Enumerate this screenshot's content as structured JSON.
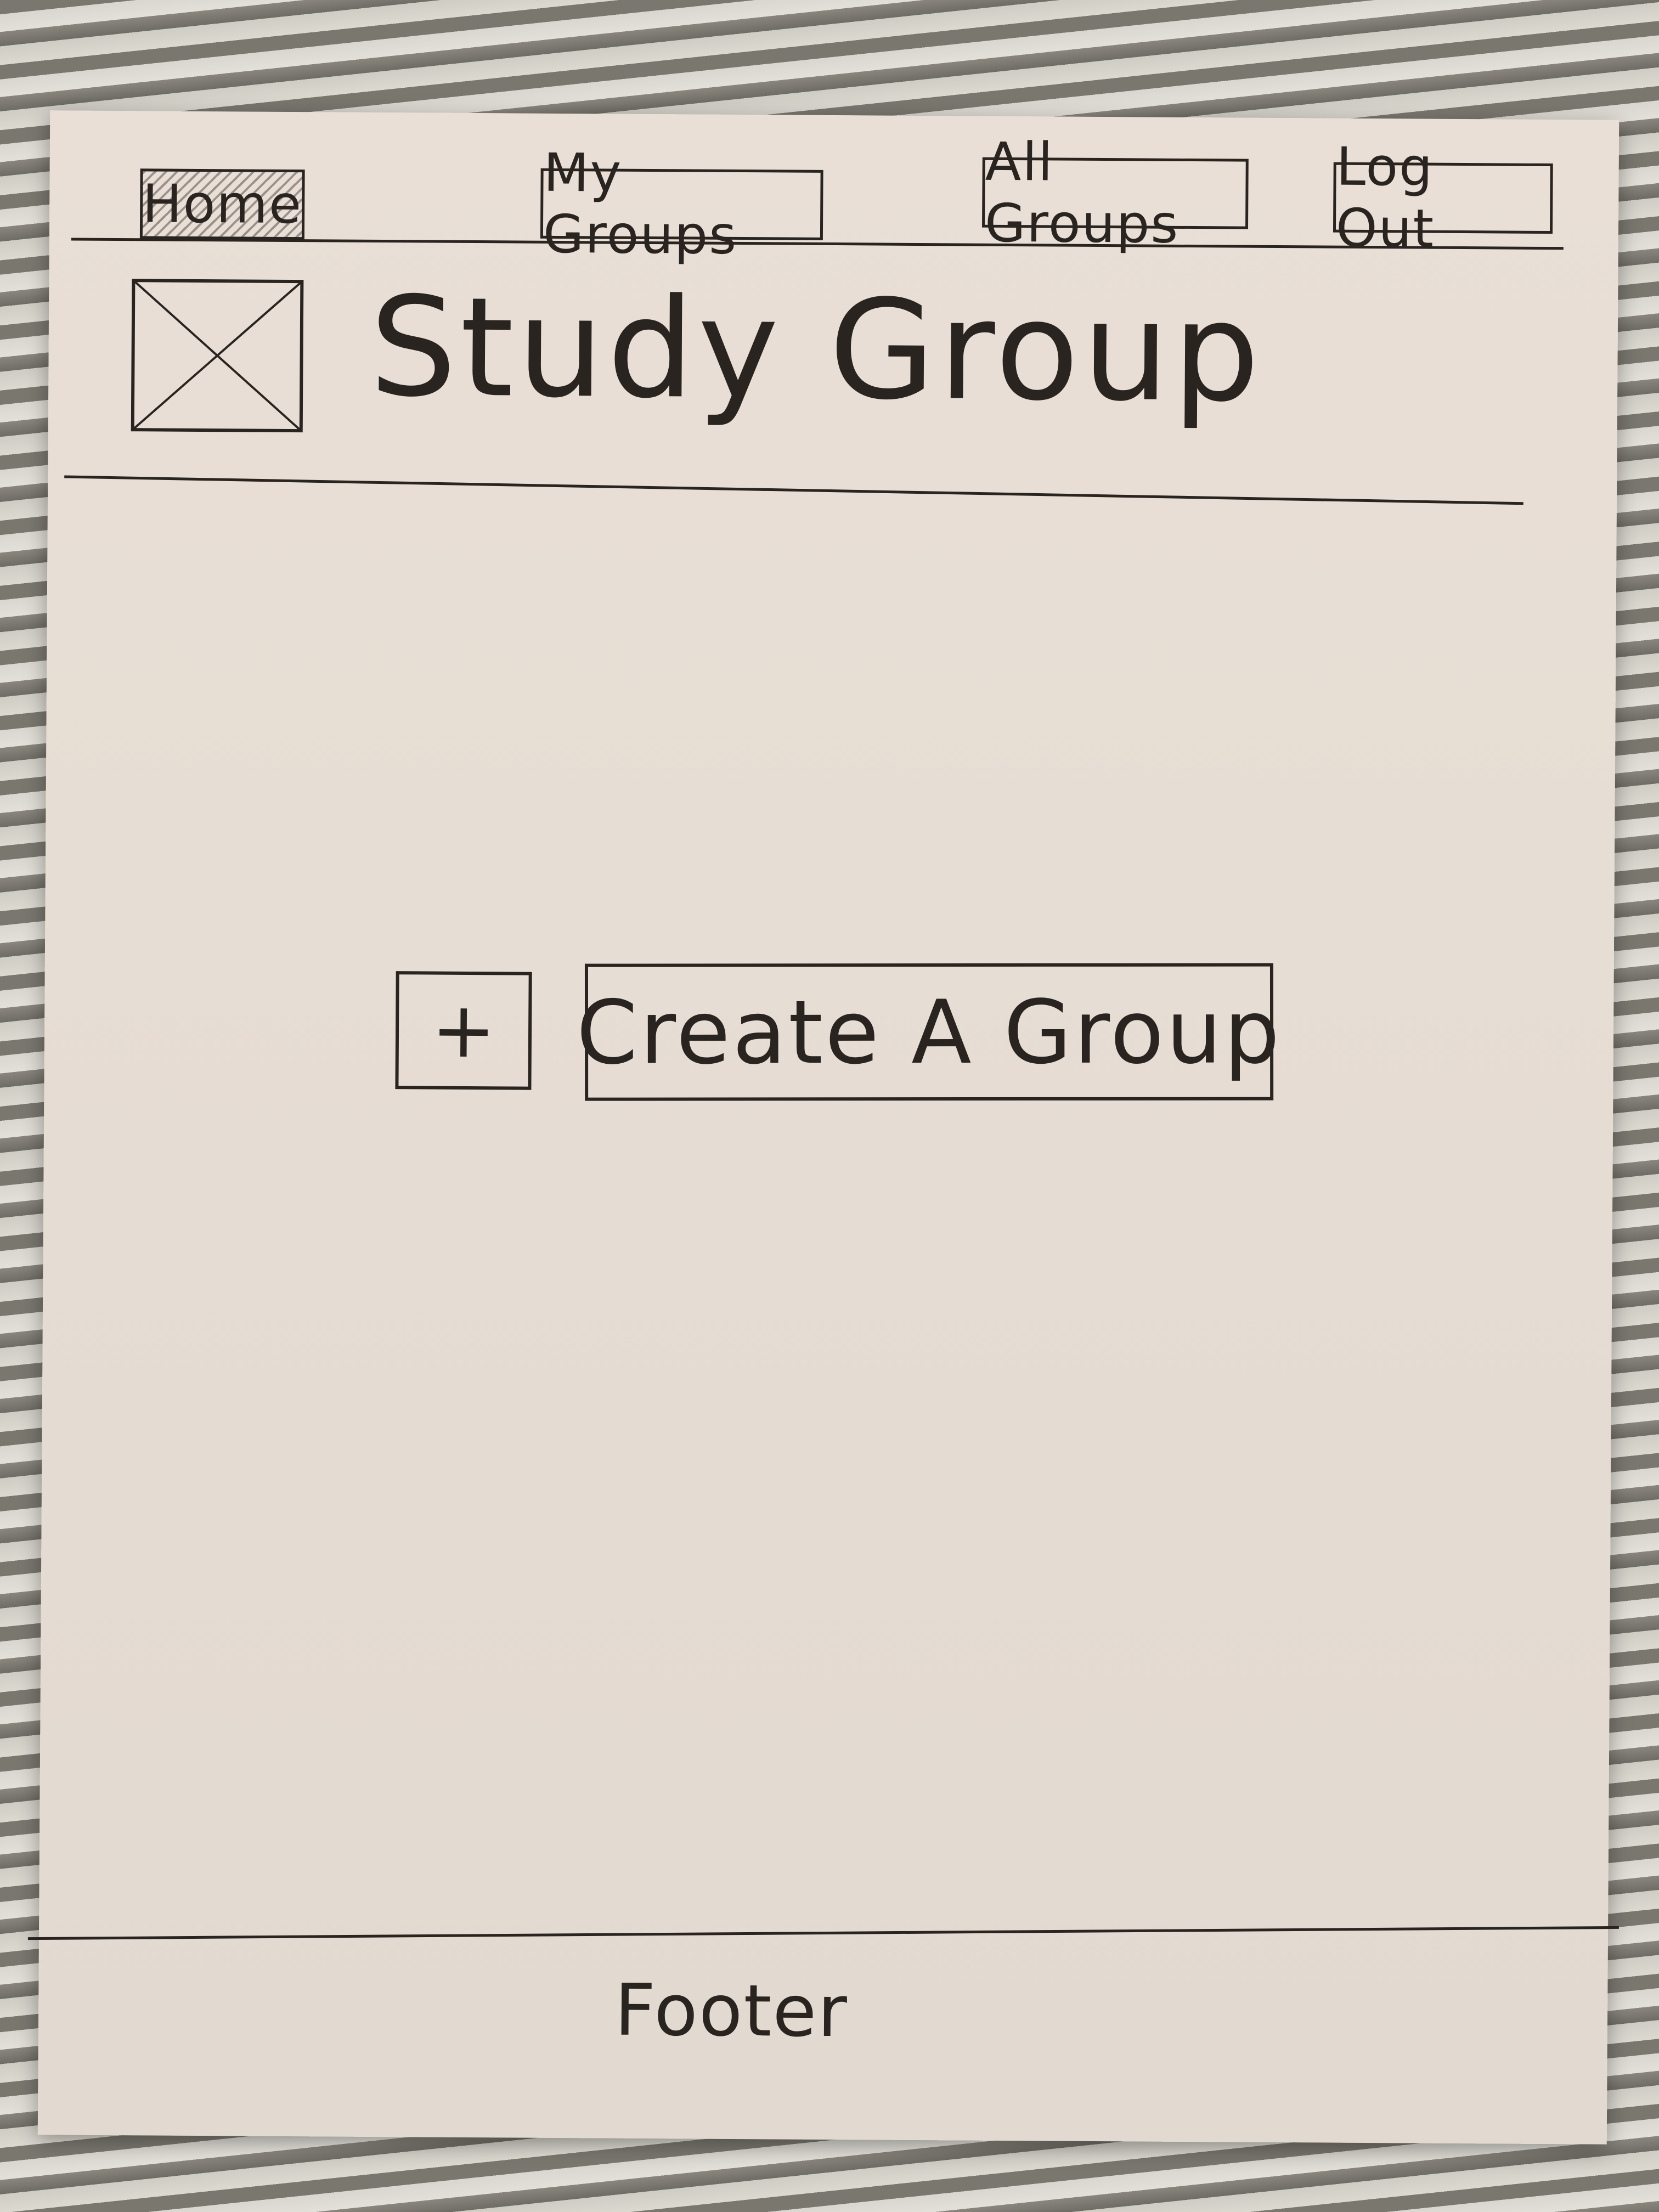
{
  "nav": {
    "items": [
      {
        "label": "Home",
        "active": true
      },
      {
        "label": "My Groups",
        "active": false
      },
      {
        "label": "All Groups",
        "active": false
      },
      {
        "label": "Log Out",
        "active": false
      }
    ]
  },
  "header": {
    "logo_icon": "image-placeholder-icon",
    "title": "Study Group"
  },
  "main": {
    "plus_label": "+",
    "create_label": "Create A Group"
  },
  "footer": {
    "label": "Footer"
  },
  "colors": {
    "ink": "#2a2420",
    "paper": "#e6ddd4"
  }
}
